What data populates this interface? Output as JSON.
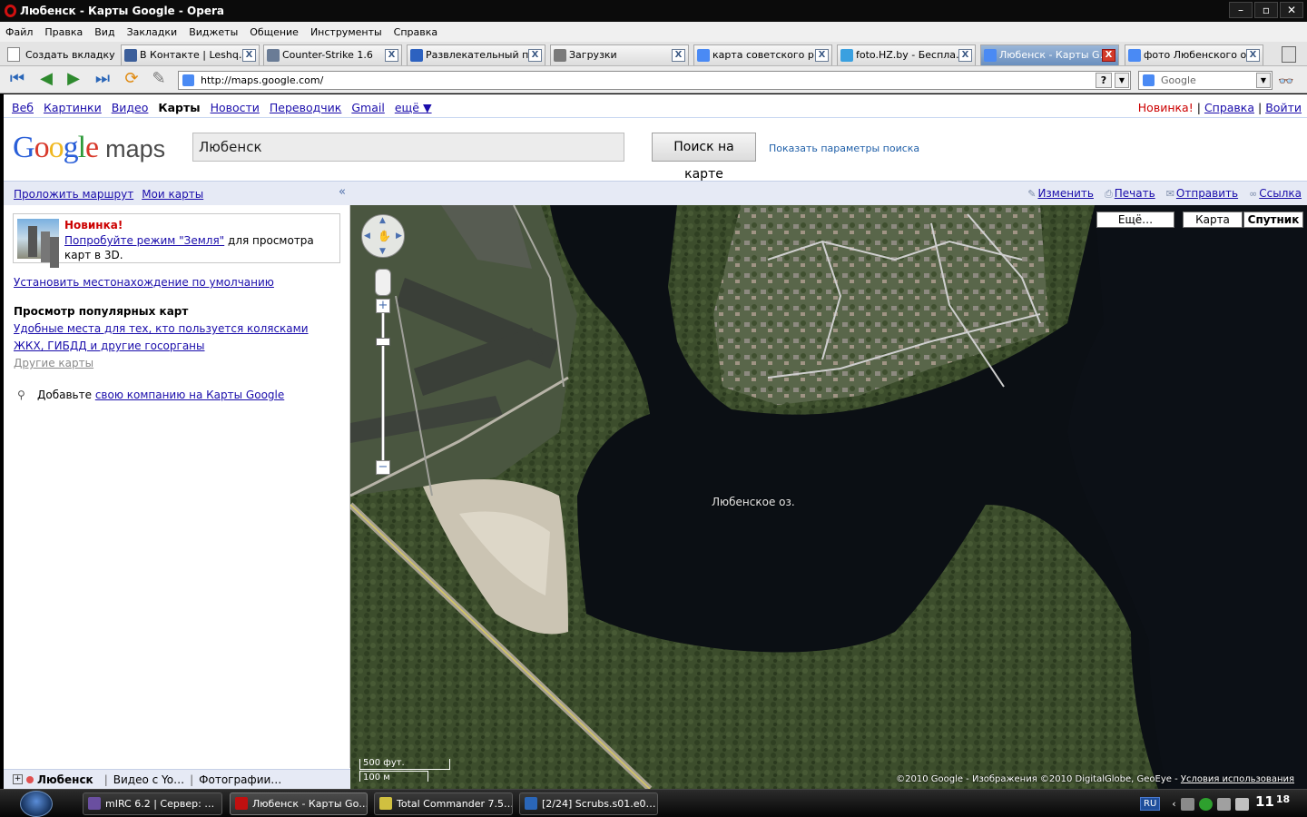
{
  "window": {
    "title": "Любенск - Карты Google - Opera"
  },
  "menu": [
    "Файл",
    "Правка",
    "Вид",
    "Закладки",
    "Виджеты",
    "Общение",
    "Инструменты",
    "Справка"
  ],
  "tabs": {
    "new_tab_label": "Создать вкладку",
    "items": [
      {
        "label": "В Контакте | Leshq…",
        "color": "#3b5e9a"
      },
      {
        "label": "Counter-Strike 1.6",
        "color": "#6a7c96"
      },
      {
        "label": "Развлекательный п…",
        "color": "#2d62c0"
      },
      {
        "label": "Загрузки",
        "color": "#7a7a7a"
      },
      {
        "label": "карта советского р…",
        "color": "#4a8af4"
      },
      {
        "label": "foto.HZ.by - Беспла…",
        "color": "#3aa0e0"
      },
      {
        "label": "Любенск - Карты G…",
        "color": "#4a8af4"
      },
      {
        "label": "фото Любенского о…",
        "color": "#4a8af4"
      }
    ],
    "close_glyph": "X"
  },
  "address": {
    "url": "http://maps.google.com/",
    "help_glyph": "?",
    "search_engine": "Google"
  },
  "gbar": {
    "links": [
      "Веб",
      "Картинки",
      "Видео",
      "Карты",
      "Новости",
      "Переводчик",
      "Gmail",
      "ещё ▼"
    ],
    "current": "Карты",
    "right_new": "Новинка!",
    "right_help": "Справка",
    "right_login": "Войти",
    "sep": "|"
  },
  "logo": {
    "google": "Google",
    "maps": "maps"
  },
  "search": {
    "value": "Любенск",
    "button": "Поиск на карте",
    "options": "Показать параметры поиска"
  },
  "actionbar": {
    "route": "Проложить маршрут",
    "my_maps": "Мои карты",
    "collapse": "«",
    "edit": "Изменить",
    "print": "Печать",
    "send": "Отправить",
    "link": "Ссылка"
  },
  "side": {
    "promo_title": "Новинка!",
    "promo_link": "Попробуйте режим \"Земля\"",
    "promo_text": " для просмотра карт в 3D.",
    "default_location": "Установить местонахождение по умолчанию",
    "popular_heading": "Просмотр популярных карт",
    "popular_1": "Удобные места для тех, кто пользуется колясками",
    "popular_2": "ЖКХ, ГИБДД и другие госорганы",
    "popular_more": "Другие карты",
    "add_text": "Добавьте ",
    "add_link": "свою компанию на Карты Google",
    "bottom_title": "Любенск",
    "bottom_videos": "Видео с Yo…",
    "bottom_photos": "Фотографии…"
  },
  "map": {
    "types": {
      "more": "Ещё…",
      "map": "Карта",
      "satellite": "Спутник"
    },
    "active_type": "Спутник",
    "lake_label": "Любенское оз.",
    "scale_ft": "500 фут.",
    "scale_m": "100 м",
    "copyright": "©2010 Google - Изображения ©2010 DigitalGlobe, GeoEye - ",
    "terms": "Условия использования",
    "zoom_in": "+",
    "zoom_out": "−"
  },
  "taskbar": {
    "items": [
      {
        "label": "mIRC 6.2 | Сервер: …",
        "color": "#6a4fa0"
      },
      {
        "label": "Любенск - Карты Go…",
        "color": "#c01010"
      },
      {
        "label": "Total Commander 7.5…",
        "color": "#d0c040"
      },
      {
        "label": "[2/24] Scrubs.s01.e0…",
        "color": "#2a66b8"
      }
    ],
    "lang": "RU",
    "clock_hour": "11",
    "clock_min": "18"
  },
  "colors": {
    "water": "#0b0f14",
    "forest": "#3c4e2c",
    "sand": "#cfc7b6",
    "link": "#1a0dab"
  }
}
